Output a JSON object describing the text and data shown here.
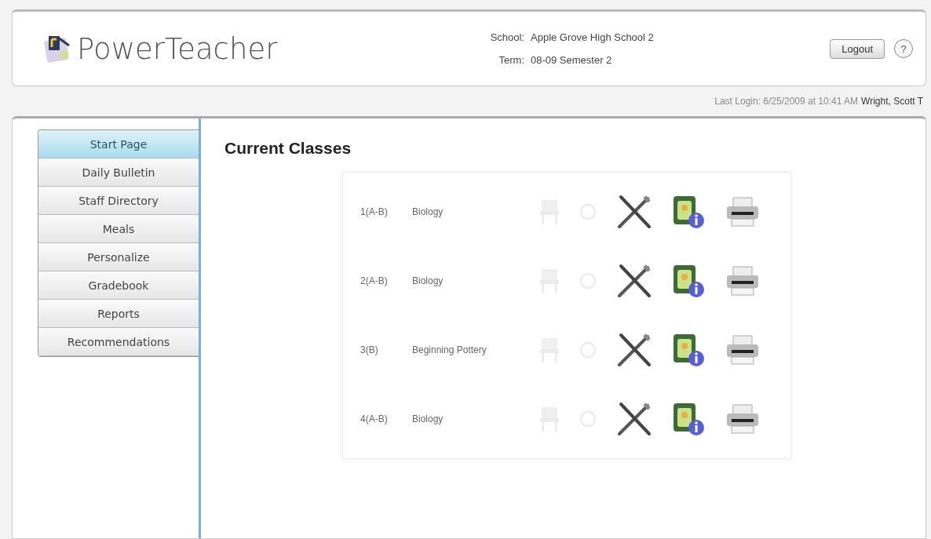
{
  "header": {
    "app_name": "PowerTeacher",
    "school_label": "School:",
    "school": "Apple Grove High School 2",
    "term_label": "Term:",
    "term": "08-09 Semester 2",
    "logout": "Logout",
    "help": "?"
  },
  "login_bar": {
    "last_login": "Last Login: 6/25/2009 at 10:41 AM",
    "user": "Wright, Scott T"
  },
  "sidebar": {
    "items": [
      {
        "label": "Start Page",
        "selected": true
      },
      {
        "label": "Daily Bulletin",
        "selected": false
      },
      {
        "label": "Staff Directory",
        "selected": false
      },
      {
        "label": "Meals",
        "selected": false
      },
      {
        "label": "Personalize",
        "selected": false
      },
      {
        "label": "Gradebook",
        "selected": false
      },
      {
        "label": "Reports",
        "selected": false
      },
      {
        "label": "Recommendations",
        "selected": false
      }
    ]
  },
  "main": {
    "title": "Current Classes",
    "classes": [
      {
        "period": "1(A-B)",
        "course": "Biology",
        "seating_disabled": true,
        "attendance_disabled": true
      },
      {
        "period": "2(A-B)",
        "course": "Biology",
        "seating_disabled": true,
        "attendance_disabled": true
      },
      {
        "period": "3(B)",
        "course": "Beginning Pottery",
        "seating_disabled": true,
        "attendance_disabled": true
      },
      {
        "period": "4(A-B)",
        "course": "Biology",
        "seating_disabled": true,
        "attendance_disabled": true
      }
    ]
  }
}
